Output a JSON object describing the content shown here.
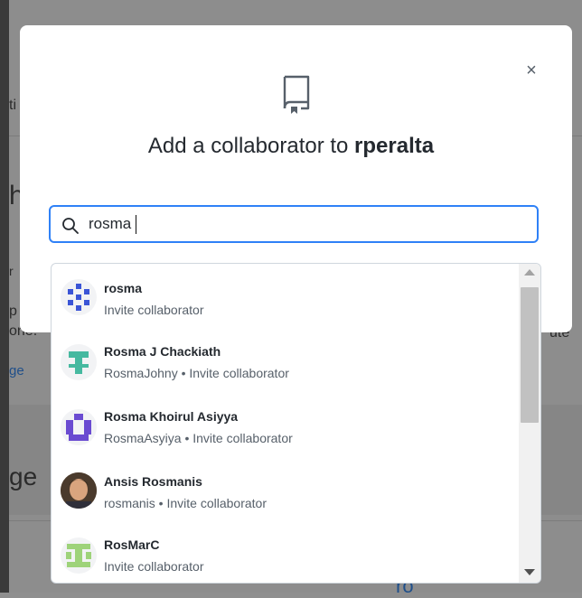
{
  "background": {
    "left_text_1": "ti",
    "left_text_2": "h",
    "left_text_3": "r",
    "left_text_4": "p",
    "left_text_5": "one.",
    "left_link": "ge",
    "right_text": "ute",
    "heading_partial": "ge",
    "bottom_link": "ro"
  },
  "modal": {
    "title_prefix": "Add a collaborator to ",
    "repo_name": "rperalta",
    "close_label": "×"
  },
  "search": {
    "value": "rosma",
    "placeholder": ""
  },
  "results": [
    {
      "name": "rosma",
      "subtitle": "Invite collaborator",
      "avatar": "identicon-blue"
    },
    {
      "name": "Rosma J Chackiath",
      "subtitle": "RosmaJohny • Invite collaborator",
      "avatar": "identicon-teal"
    },
    {
      "name": "Rosma Khoirul Asiyya",
      "subtitle": "RosmaAsyiya • Invite collaborator",
      "avatar": "identicon-purple"
    },
    {
      "name": "Ansis Rosmanis",
      "subtitle": "rosmanis • Invite collaborator",
      "avatar": "photo"
    },
    {
      "name": "RosMarC",
      "subtitle": "Invite collaborator",
      "avatar": "identicon-green"
    }
  ],
  "colors": {
    "accent": "#2f81f7",
    "identicon_blue": "#3b55d6",
    "identicon_teal": "#46b9a0",
    "identicon_purple": "#6a4bd1",
    "identicon_green": "#9ed37a"
  }
}
